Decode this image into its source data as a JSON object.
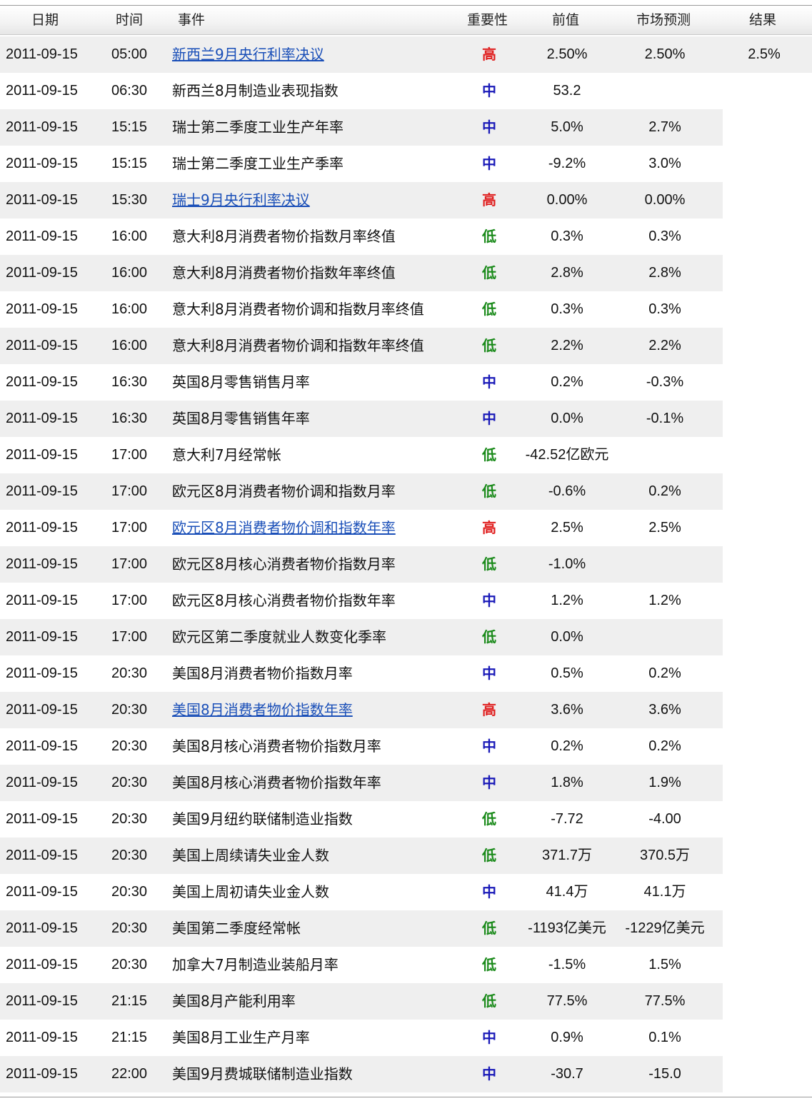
{
  "columns": {
    "date": "日期",
    "time": "时间",
    "event": "事件",
    "importance": "重要性",
    "previous": "前值",
    "forecast": "市场预测",
    "result": "结果"
  },
  "colors": {
    "high": "#e02020",
    "medium": "#1a1ab8",
    "low": "#1a8a1a",
    "link": "#1a4fb8",
    "row_alt_bg": "#efefef"
  },
  "rows": [
    {
      "date": "2011-09-15",
      "time": "05:00",
      "event": "新西兰9月央行利率决议",
      "link": true,
      "importance": "高",
      "level": "high",
      "previous": "2.50%",
      "forecast": "2.50%",
      "result": "2.5%"
    },
    {
      "date": "2011-09-15",
      "time": "06:30",
      "event": "新西兰8月制造业表现指数",
      "link": false,
      "importance": "中",
      "level": "medium",
      "previous": "53.2",
      "forecast": "",
      "result": ""
    },
    {
      "date": "2011-09-15",
      "time": "15:15",
      "event": "瑞士第二季度工业生产年率",
      "link": false,
      "importance": "中",
      "level": "medium",
      "previous": "5.0%",
      "forecast": "2.7%",
      "result": ""
    },
    {
      "date": "2011-09-15",
      "time": "15:15",
      "event": "瑞士第二季度工业生产季率",
      "link": false,
      "importance": "中",
      "level": "medium",
      "previous": "-9.2%",
      "forecast": "3.0%",
      "result": ""
    },
    {
      "date": "2011-09-15",
      "time": "15:30",
      "event": "瑞士9月央行利率决议",
      "link": true,
      "importance": "高",
      "level": "high",
      "previous": "0.00%",
      "forecast": "0.00%",
      "result": ""
    },
    {
      "date": "2011-09-15",
      "time": "16:00",
      "event": "意大利8月消费者物价指数月率终值",
      "link": false,
      "importance": "低",
      "level": "low",
      "previous": "0.3%",
      "forecast": "0.3%",
      "result": ""
    },
    {
      "date": "2011-09-15",
      "time": "16:00",
      "event": "意大利8月消费者物价指数年率终值",
      "link": false,
      "importance": "低",
      "level": "low",
      "previous": "2.8%",
      "forecast": "2.8%",
      "result": ""
    },
    {
      "date": "2011-09-15",
      "time": "16:00",
      "event": "意大利8月消费者物价调和指数月率终值",
      "link": false,
      "importance": "低",
      "level": "low",
      "previous": "0.3%",
      "forecast": "0.3%",
      "result": ""
    },
    {
      "date": "2011-09-15",
      "time": "16:00",
      "event": "意大利8月消费者物价调和指数年率终值",
      "link": false,
      "importance": "低",
      "level": "low",
      "previous": "2.2%",
      "forecast": "2.2%",
      "result": ""
    },
    {
      "date": "2011-09-15",
      "time": "16:30",
      "event": "英国8月零售销售月率",
      "link": false,
      "importance": "中",
      "level": "medium",
      "previous": "0.2%",
      "forecast": "-0.3%",
      "result": ""
    },
    {
      "date": "2011-09-15",
      "time": "16:30",
      "event": "英国8月零售销售年率",
      "link": false,
      "importance": "中",
      "level": "medium",
      "previous": "0.0%",
      "forecast": "-0.1%",
      "result": ""
    },
    {
      "date": "2011-09-15",
      "time": "17:00",
      "event": "意大利7月经常帐",
      "link": false,
      "importance": "低",
      "level": "low",
      "previous": "-42.52亿欧元",
      "forecast": "",
      "result": ""
    },
    {
      "date": "2011-09-15",
      "time": "17:00",
      "event": "欧元区8月消费者物价调和指数月率",
      "link": false,
      "importance": "低",
      "level": "low",
      "previous": "-0.6%",
      "forecast": "0.2%",
      "result": ""
    },
    {
      "date": "2011-09-15",
      "time": "17:00",
      "event": "欧元区8月消费者物价调和指数年率",
      "link": true,
      "importance": "高",
      "level": "high",
      "previous": "2.5%",
      "forecast": "2.5%",
      "result": ""
    },
    {
      "date": "2011-09-15",
      "time": "17:00",
      "event": "欧元区8月核心消费者物价指数月率",
      "link": false,
      "importance": "低",
      "level": "low",
      "previous": "-1.0%",
      "forecast": "",
      "result": ""
    },
    {
      "date": "2011-09-15",
      "time": "17:00",
      "event": "欧元区8月核心消费者物价指数年率",
      "link": false,
      "importance": "中",
      "level": "medium",
      "previous": "1.2%",
      "forecast": "1.2%",
      "result": ""
    },
    {
      "date": "2011-09-15",
      "time": "17:00",
      "event": "欧元区第二季度就业人数变化季率",
      "link": false,
      "importance": "低",
      "level": "low",
      "previous": "0.0%",
      "forecast": "",
      "result": ""
    },
    {
      "date": "2011-09-15",
      "time": "20:30",
      "event": "美国8月消费者物价指数月率",
      "link": false,
      "importance": "中",
      "level": "medium",
      "previous": "0.5%",
      "forecast": "0.2%",
      "result": ""
    },
    {
      "date": "2011-09-15",
      "time": "20:30",
      "event": "美国8月消费者物价指数年率",
      "link": true,
      "importance": "高",
      "level": "high",
      "previous": "3.6%",
      "forecast": "3.6%",
      "result": ""
    },
    {
      "date": "2011-09-15",
      "time": "20:30",
      "event": "美国8月核心消费者物价指数月率",
      "link": false,
      "importance": "中",
      "level": "medium",
      "previous": "0.2%",
      "forecast": "0.2%",
      "result": ""
    },
    {
      "date": "2011-09-15",
      "time": "20:30",
      "event": "美国8月核心消费者物价指数年率",
      "link": false,
      "importance": "中",
      "level": "medium",
      "previous": "1.8%",
      "forecast": "1.9%",
      "result": ""
    },
    {
      "date": "2011-09-15",
      "time": "20:30",
      "event": "美国9月纽约联储制造业指数",
      "link": false,
      "importance": "低",
      "level": "low",
      "previous": "-7.72",
      "forecast": "-4.00",
      "result": ""
    },
    {
      "date": "2011-09-15",
      "time": "20:30",
      "event": "美国上周续请失业金人数",
      "link": false,
      "importance": "低",
      "level": "low",
      "previous": "371.7万",
      "forecast": "370.5万",
      "result": ""
    },
    {
      "date": "2011-09-15",
      "time": "20:30",
      "event": "美国上周初请失业金人数",
      "link": false,
      "importance": "中",
      "level": "medium",
      "previous": "41.4万",
      "forecast": "41.1万",
      "result": ""
    },
    {
      "date": "2011-09-15",
      "time": "20:30",
      "event": "美国第二季度经常帐",
      "link": false,
      "importance": "低",
      "level": "low",
      "previous": "-1193亿美元",
      "forecast": "-1229亿美元",
      "result": ""
    },
    {
      "date": "2011-09-15",
      "time": "20:30",
      "event": "加拿大7月制造业装船月率",
      "link": false,
      "importance": "低",
      "level": "low",
      "previous": "-1.5%",
      "forecast": "1.5%",
      "result": ""
    },
    {
      "date": "2011-09-15",
      "time": "21:15",
      "event": "美国8月产能利用率",
      "link": false,
      "importance": "低",
      "level": "low",
      "previous": "77.5%",
      "forecast": "77.5%",
      "result": ""
    },
    {
      "date": "2011-09-15",
      "time": "21:15",
      "event": "美国8月工业生产月率",
      "link": false,
      "importance": "中",
      "level": "medium",
      "previous": "0.9%",
      "forecast": "0.1%",
      "result": ""
    },
    {
      "date": "2011-09-15",
      "time": "22:00",
      "event": "美国9月费城联储制造业指数",
      "link": false,
      "importance": "中",
      "level": "medium",
      "previous": "-30.7",
      "forecast": "-15.0",
      "result": ""
    }
  ]
}
